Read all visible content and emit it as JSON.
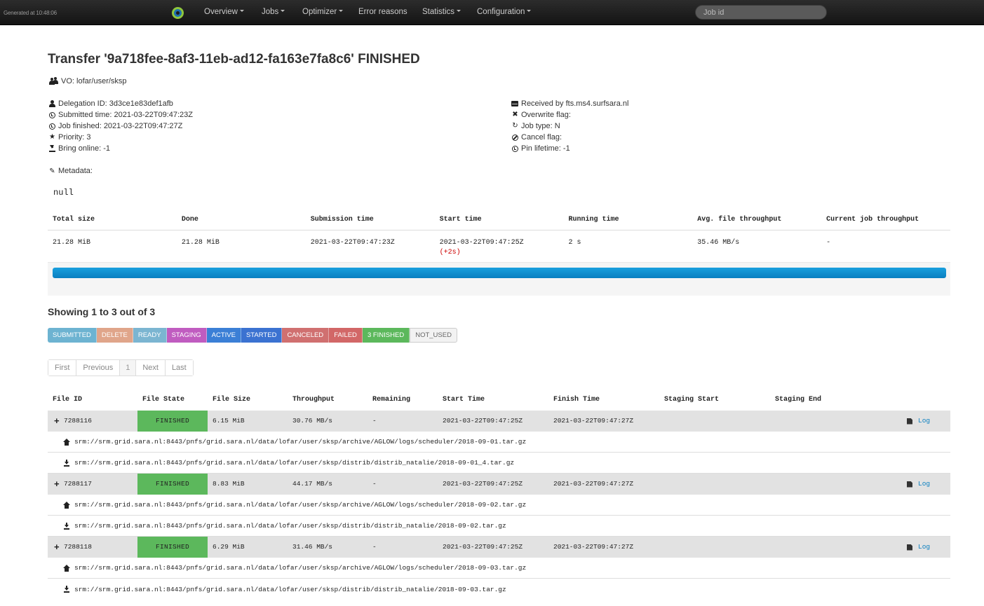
{
  "navbar": {
    "generated_at": "Generated at 10:48:06",
    "items": [
      {
        "label": "Overview",
        "dropdown": true
      },
      {
        "label": "Jobs",
        "dropdown": true
      },
      {
        "label": "Optimizer",
        "dropdown": true
      },
      {
        "label": "Error reasons",
        "dropdown": false
      },
      {
        "label": "Statistics",
        "dropdown": true
      },
      {
        "label": "Configuration",
        "dropdown": true
      }
    ],
    "search_placeholder": "Job id"
  },
  "header": {
    "title": "Transfer '9a718fee-8af3-11eb-ad12-fa163e7fa8c6' FINISHED",
    "vo": "VO: lofar/user/sksp"
  },
  "info_left": {
    "delegation": "Delegation ID: 3d3ce1e83def1afb",
    "submitted": "Submitted time: 2021-03-22T09:47:23Z",
    "finished": "Job finished: 2021-03-22T09:47:27Z",
    "priority": "Priority: 3",
    "bring_online": "Bring online: -1"
  },
  "info_right": {
    "received": "Received by fts.ms4.surfsara.nl",
    "overwrite": "Overwrite flag:",
    "job_type": "Job type: N",
    "cancel": "Cancel flag:",
    "pin": "Pin lifetime: -1"
  },
  "metadata": {
    "label": "Metadata:",
    "value": "null"
  },
  "summary": {
    "headers": [
      "Total size",
      "Done",
      "Submission time",
      "Start time",
      "Running time",
      "Avg. file throughput",
      "Current job throughput"
    ],
    "values": [
      "21.28 MiB",
      "21.28 MiB",
      "2021-03-22T09:47:23Z",
      "2021-03-22T09:47:25Z",
      "2 s",
      "35.46 MB/s",
      "-"
    ],
    "start_delta": "(+2s)",
    "progress_percent": 100,
    "progress_color": "#0a7fc0"
  },
  "showing": "Showing 1 to 3 out of 3",
  "states": [
    {
      "label": "SUBMITTED",
      "color": "#6db3d1"
    },
    {
      "label": "DELETE",
      "color": "#e0a58a"
    },
    {
      "label": "READY",
      "color": "#7bb5d1"
    },
    {
      "label": "STAGING",
      "color": "#c05cc0"
    },
    {
      "label": "ACTIVE",
      "color": "#3b7fd6"
    },
    {
      "label": "STARTED",
      "color": "#3b72d1"
    },
    {
      "label": "CANCELED",
      "color": "#d07070"
    },
    {
      "label": "FAILED",
      "color": "#d26767"
    },
    {
      "label": "3 FINISHED",
      "color": "#5cb85c"
    },
    {
      "label": "NOT_USED",
      "color": "#f2f2f2"
    }
  ],
  "pager": {
    "first": "First",
    "previous": "Previous",
    "current": "1",
    "next": "Next",
    "last": "Last"
  },
  "files": {
    "headers": [
      "File ID",
      "File State",
      "File Size",
      "Throughput",
      "Remaining",
      "Start Time",
      "Finish Time",
      "Staging Start",
      "Staging End"
    ],
    "log_label": "Log",
    "rows": [
      {
        "id": "7288116",
        "state": "FINISHED",
        "size": "6.15 MiB",
        "throughput": "30.76 MB/s",
        "remaining": "-",
        "start": "2021-03-22T09:47:25Z",
        "finish": "2021-03-22T09:47:27Z",
        "staging_start": "",
        "staging_end": "",
        "source": "srm://srm.grid.sara.nl:8443/pnfs/grid.sara.nl/data/lofar/user/sksp/archive/AGLOW/logs/scheduler/2018-09-01.tar.gz",
        "dest": "srm://srm.grid.sara.nl:8443/pnfs/grid.sara.nl/data/lofar/user/sksp/distrib/distrib_natalie/2018-09-01_4.tar.gz"
      },
      {
        "id": "7288117",
        "state": "FINISHED",
        "size": "8.83 MiB",
        "throughput": "44.17 MB/s",
        "remaining": "-",
        "start": "2021-03-22T09:47:25Z",
        "finish": "2021-03-22T09:47:27Z",
        "staging_start": "",
        "staging_end": "",
        "source": "srm://srm.grid.sara.nl:8443/pnfs/grid.sara.nl/data/lofar/user/sksp/archive/AGLOW/logs/scheduler/2018-09-02.tar.gz",
        "dest": "srm://srm.grid.sara.nl:8443/pnfs/grid.sara.nl/data/lofar/user/sksp/distrib/distrib_natalie/2018-09-02.tar.gz"
      },
      {
        "id": "7288118",
        "state": "FINISHED",
        "size": "6.29 MiB",
        "throughput": "31.46 MB/s",
        "remaining": "-",
        "start": "2021-03-22T09:47:25Z",
        "finish": "2021-03-22T09:47:27Z",
        "staging_start": "",
        "staging_end": "",
        "source": "srm://srm.grid.sara.nl:8443/pnfs/grid.sara.nl/data/lofar/user/sksp/archive/AGLOW/logs/scheduler/2018-09-03.tar.gz",
        "dest": "srm://srm.grid.sara.nl:8443/pnfs/grid.sara.nl/data/lofar/user/sksp/distrib/distrib_natalie/2018-09-03.tar.gz"
      }
    ]
  }
}
